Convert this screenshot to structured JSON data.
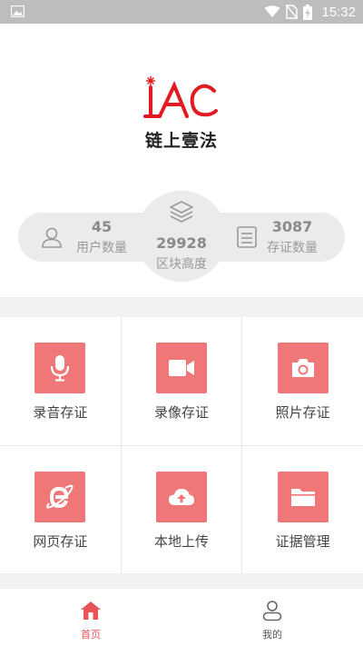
{
  "status_bar": {
    "time": "15:32",
    "icons": [
      "image-icon",
      "wifi-icon",
      "no-sim-icon",
      "battery-charging-icon"
    ]
  },
  "brand": {
    "logo_icon": "iac-logo",
    "app_name": "链上壹法",
    "logo_color": "#e21b23"
  },
  "stats": {
    "users": {
      "value": "45",
      "label": "用户数量",
      "icon": "user-icon"
    },
    "block_height": {
      "value": "29928",
      "label": "区块高度",
      "icon": "layers-icon"
    },
    "evidence": {
      "value": "3087",
      "label": "存证数量",
      "icon": "clipboard-icon"
    }
  },
  "actions": [
    {
      "label": "录音存证",
      "icon": "microphone-icon"
    },
    {
      "label": "录像存证",
      "icon": "video-camera-icon"
    },
    {
      "label": "照片存证",
      "icon": "camera-icon"
    },
    {
      "label": "网页存证",
      "icon": "browser-e-icon"
    },
    {
      "label": "本地上传",
      "icon": "cloud-upload-icon"
    },
    {
      "label": "证据管理",
      "icon": "folder-icon"
    }
  ],
  "tabbar": {
    "home": {
      "label": "首页",
      "icon": "home-icon",
      "active": true
    },
    "mine": {
      "label": "我的",
      "icon": "profile-icon",
      "active": false
    }
  },
  "colors": {
    "accent": "#e95557",
    "tile": "#ef7778",
    "status_bar": "#bdbdbd",
    "stats_bg": "#ebebeb"
  }
}
